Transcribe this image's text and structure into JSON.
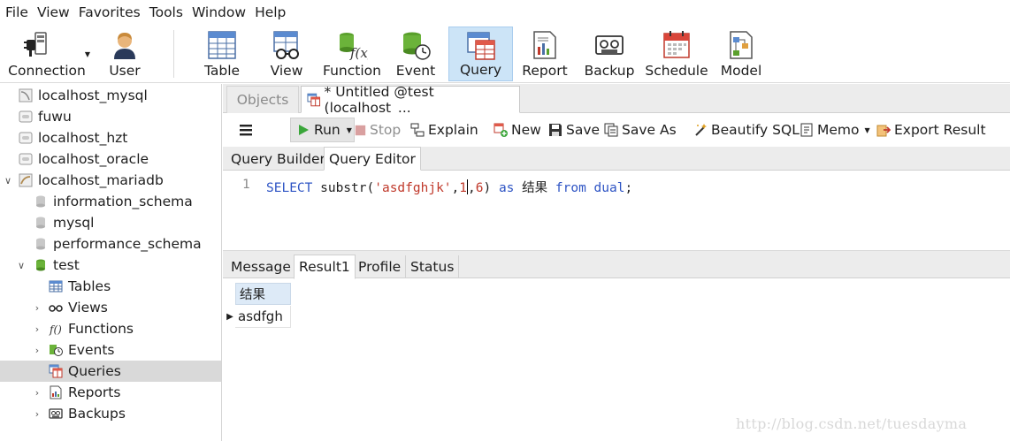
{
  "menu": [
    "File",
    "View",
    "Favorites",
    "Tools",
    "Window",
    "Help"
  ],
  "ribbon": {
    "connection": "Connection",
    "user": "User",
    "table": "Table",
    "view": "View",
    "function": "Function",
    "event": "Event",
    "query": "Query",
    "report": "Report",
    "backup": "Backup",
    "schedule": "Schedule",
    "model": "Model"
  },
  "navigator": {
    "connections": [
      "localhost_mysql",
      "fuwu",
      "localhost_hzt",
      "localhost_oracle",
      "localhost_mariadb"
    ],
    "databases": [
      "information_schema",
      "mysql",
      "performance_schema",
      "test"
    ],
    "objects": [
      "Tables",
      "Views",
      "Functions",
      "Events",
      "Queries",
      "Reports",
      "Backups"
    ],
    "selected": "Queries"
  },
  "tabs": {
    "objects": "Objects",
    "untitled": "* Untitled @test (localhost_..."
  },
  "toolbar": {
    "run": "Run",
    "stop": "Stop",
    "explain": "Explain",
    "new": "New",
    "save": "Save",
    "save_as": "Save As",
    "beautify": "Beautify SQL",
    "memo": "Memo",
    "export": "Export Result"
  },
  "subtabs": {
    "builder": "Query Builder",
    "editor": "Query Editor"
  },
  "editor": {
    "line_number": "1",
    "sql": {
      "kw_select": "SELECT",
      "fn": " substr(",
      "str": "'asdfghjk'",
      "comma1": ",",
      "num1": "1",
      "comma2": ",",
      "num2": "6",
      "close": ") ",
      "kw_as": "as",
      "alias": " 结果 ",
      "kw_from": "from",
      "sp": " ",
      "kw_dual": "dual",
      "semi": ";"
    }
  },
  "result_tabs": [
    "Message",
    "Result1",
    "Profile",
    "Status"
  ],
  "result": {
    "column": "结果",
    "rows": [
      "asdfgh"
    ]
  },
  "watermark": "http://blog.csdn.net/tuesdayma",
  "colors": {
    "accent": "#cce4f7",
    "keyword": "#2e54c4",
    "string": "#c0392b",
    "selection": "#d9d9d9"
  }
}
